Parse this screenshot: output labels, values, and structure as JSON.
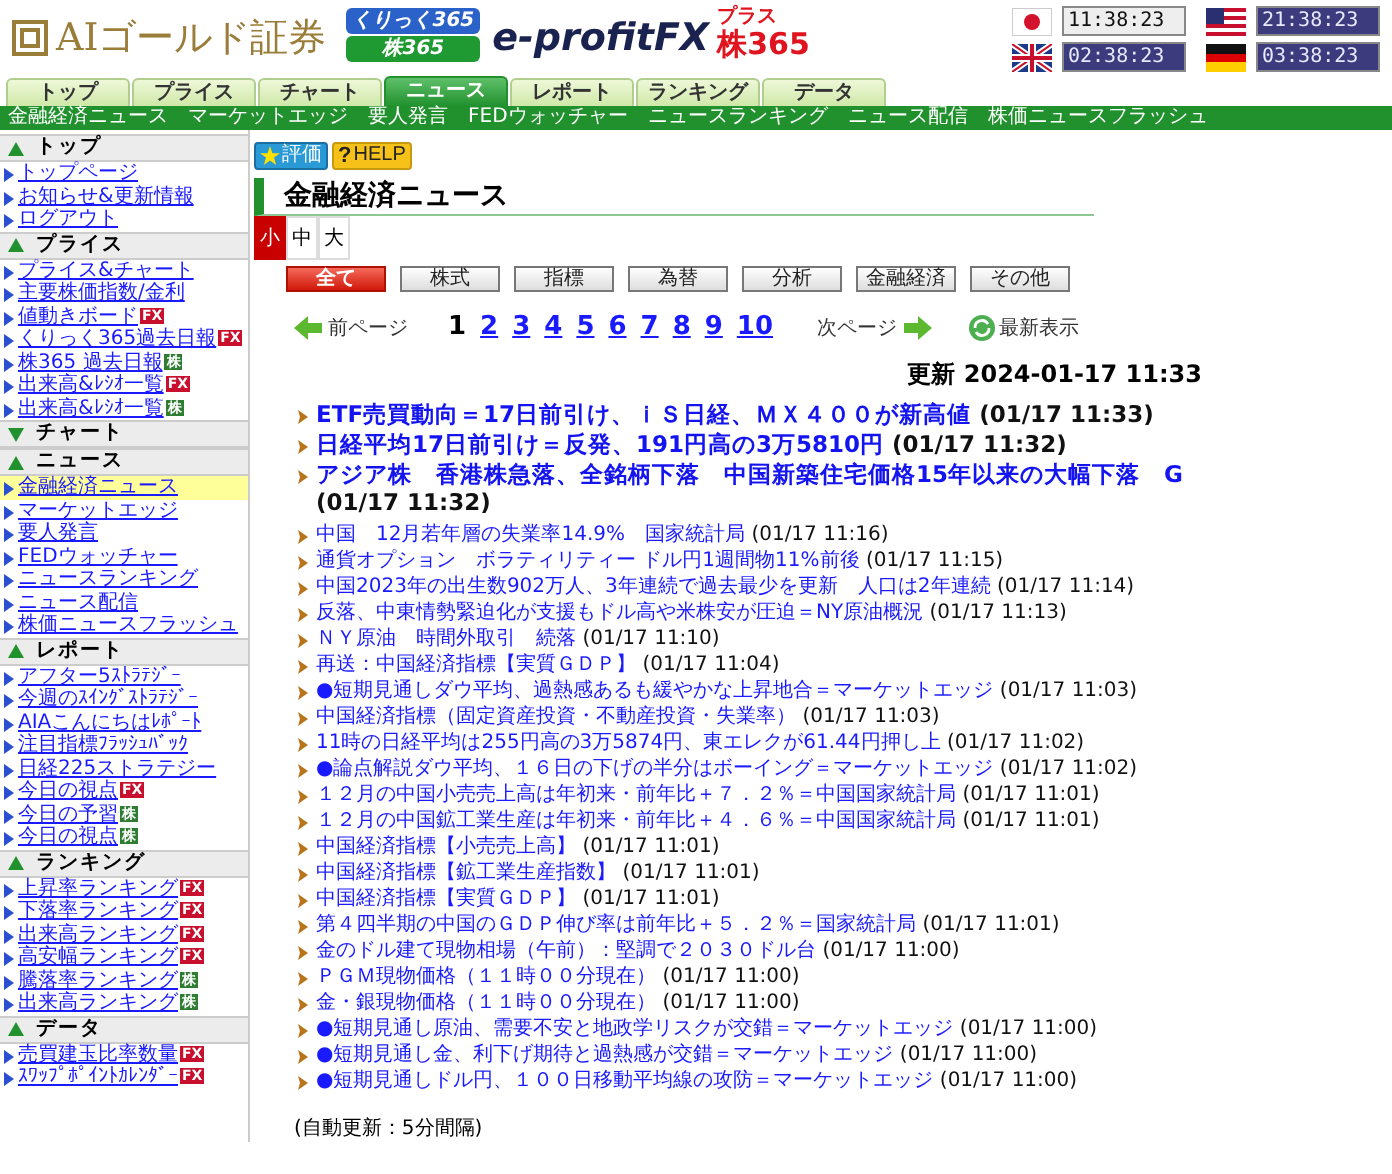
{
  "header": {
    "logo": "AIゴールド証券",
    "badges": [
      {
        "kind": "blue",
        "text": "くりっく365"
      },
      {
        "kind": "green",
        "text": "株365"
      }
    ],
    "brand": "e-profitFX",
    "brand_plus": "プラス",
    "brand_kabu": "株365",
    "clocks": [
      {
        "kind": "jp",
        "time": "11:38:23",
        "local": true
      },
      {
        "kind": "us",
        "time": "21:38:23",
        "local": false
      },
      {
        "kind": "gb",
        "time": "02:38:23",
        "local": false
      },
      {
        "kind": "de",
        "time": "03:38:23",
        "local": false
      }
    ]
  },
  "tabs": [
    {
      "label": "トップ",
      "selected": false
    },
    {
      "label": "プライス",
      "selected": false
    },
    {
      "label": "チャート",
      "selected": false
    },
    {
      "label": "ニュース",
      "selected": true
    },
    {
      "label": "レポート",
      "selected": false
    },
    {
      "label": "ランキング",
      "selected": false
    },
    {
      "label": "データ",
      "selected": false
    }
  ],
  "subnav": [
    "金融経済ニュース",
    "マーケットエッジ",
    "要人発言",
    "FEDウォッチャー",
    "ニュースランキング",
    "ニュース配信",
    "株価ニュースフラッシュ"
  ],
  "sidebar": [
    {
      "title": "トップ",
      "expanded": true,
      "items": [
        {
          "label": "トップページ",
          "selected": false
        },
        {
          "label": "お知らせ&更新情報",
          "selected": false
        },
        {
          "label": "ログアウト",
          "selected": false
        }
      ]
    },
    {
      "title": "プライス",
      "expanded": true,
      "items": [
        {
          "label": "プライス&チャート",
          "selected": false
        },
        {
          "label": "主要株価指数/金利",
          "selected": false
        },
        {
          "label": "値動きボード",
          "selected": false,
          "badge": {
            "kind": "fx",
            "text": "FX"
          }
        },
        {
          "label": "くりっく365過去日報",
          "selected": false,
          "badge": {
            "kind": "fx",
            "text": "FX"
          }
        },
        {
          "label": "株365 過去日報",
          "selected": false,
          "badge": {
            "kind": "kabu",
            "text": "株"
          }
        },
        {
          "label": "出来高&ﾚｼｵ一覧",
          "selected": false,
          "badge": {
            "kind": "fx",
            "text": "FX"
          }
        },
        {
          "label": "出来高&ﾚｼｵ一覧",
          "selected": false,
          "badge": {
            "kind": "kabu",
            "text": "株"
          }
        }
      ]
    },
    {
      "title": "チャート",
      "expanded": false
    },
    {
      "title": "ニュース",
      "expanded": true,
      "items": [
        {
          "label": "金融経済ニュース",
          "selected": true
        },
        {
          "label": "マーケットエッジ",
          "selected": false
        },
        {
          "label": "要人発言",
          "selected": false
        },
        {
          "label": "FEDウォッチャー",
          "selected": false
        },
        {
          "label": "ニュースランキング",
          "selected": false
        },
        {
          "label": "ニュース配信",
          "selected": false
        },
        {
          "label": "株価ニュースフラッシュ",
          "selected": false
        }
      ]
    },
    {
      "title": "レポート",
      "expanded": true,
      "items": [
        {
          "label": "アフター5ｽﾄﾗﾃｼﾞｰ",
          "selected": false
        },
        {
          "label": "今週のｽｲﾝｸﾞｽﾄﾗﾃｼﾞｰ",
          "selected": false
        },
        {
          "label": "AIAこんにちはﾚﾎﾟｰﾄ",
          "selected": false
        },
        {
          "label": "注目指標ﾌﾗｯｼｭﾊﾞｯｸ",
          "selected": false
        },
        {
          "label": "日経225ストラテジー",
          "selected": false
        },
        {
          "label": "今日の視点",
          "selected": false,
          "badge": {
            "kind": "fx",
            "text": "FX"
          }
        },
        {
          "label": "今日の予習",
          "selected": false,
          "badge": {
            "kind": "kabu",
            "text": "株"
          }
        },
        {
          "label": "今日の視点",
          "selected": false,
          "badge": {
            "kind": "kabu",
            "text": "株"
          }
        }
      ]
    },
    {
      "title": "ランキング",
      "expanded": true,
      "items": [
        {
          "label": "上昇率ランキング",
          "selected": false,
          "badge": {
            "kind": "fx",
            "text": "FX"
          }
        },
        {
          "label": "下落率ランキング",
          "selected": false,
          "badge": {
            "kind": "fx",
            "text": "FX"
          }
        },
        {
          "label": "出来高ランキング",
          "selected": false,
          "badge": {
            "kind": "fx",
            "text": "FX"
          }
        },
        {
          "label": "高安幅ランキング",
          "selected": false,
          "badge": {
            "kind": "fx",
            "text": "FX"
          }
        },
        {
          "label": "騰落率ランキング",
          "selected": false,
          "badge": {
            "kind": "kabu",
            "text": "株"
          }
        },
        {
          "label": "出来高ランキング",
          "selected": false,
          "badge": {
            "kind": "kabu",
            "text": "株"
          }
        }
      ]
    },
    {
      "title": "データ",
      "expanded": true,
      "items": [
        {
          "label": "売買建玉比率数量",
          "selected": false,
          "badge": {
            "kind": "fx",
            "text": "FX"
          }
        },
        {
          "label": "ｽﾜｯﾌﾟﾎﾟｲﾝﾄｶﾚﾝﾀﾞｰ",
          "selected": false,
          "badge": {
            "kind": "fx",
            "text": "FX"
          }
        }
      ]
    }
  ],
  "main": {
    "rate_button": "評価",
    "help_mark": "?",
    "help_button": "HELP",
    "title": "金融経済ニュース",
    "font_sizes": [
      {
        "label": "小",
        "selected": true
      },
      {
        "label": "中",
        "selected": false
      },
      {
        "label": "大",
        "selected": false
      }
    ],
    "categories": [
      {
        "label": "全て",
        "selected": true
      },
      {
        "label": "株式",
        "selected": false
      },
      {
        "label": "指標",
        "selected": false
      },
      {
        "label": "為替",
        "selected": false
      },
      {
        "label": "分析",
        "selected": false
      },
      {
        "label": "金融経済",
        "selected": false
      },
      {
        "label": "その他",
        "selected": false
      }
    ],
    "pagination": {
      "prev": "前ページ",
      "pages": [
        {
          "label": "1",
          "selected": true
        },
        {
          "label": "2",
          "selected": false
        },
        {
          "label": "3",
          "selected": false
        },
        {
          "label": "4",
          "selected": false
        },
        {
          "label": "5",
          "selected": false
        },
        {
          "label": "6",
          "selected": false
        },
        {
          "label": "7",
          "selected": false
        },
        {
          "label": "8",
          "selected": false
        },
        {
          "label": "9",
          "selected": false
        },
        {
          "label": "10",
          "selected": false
        }
      ],
      "next": "次ページ",
      "refresh": "最新表示"
    },
    "updated": "更新 2024-01-17 11:33",
    "headlines": [
      {
        "title": "ETF売買動向＝17日前引け、ｉＳ日経、ＭＸ４００が新高値",
        "time": "(01/17 11:33)"
      },
      {
        "title": "日経平均17日前引け＝反発、191円高の3万5810円",
        "time": "(01/17 11:32)"
      },
      {
        "title": "アジア株　香港株急落、全銘柄下落　中国新築住宅価格15年以来の大幅下落　G",
        "time": "(01/17 11:32)"
      }
    ],
    "news": [
      {
        "title": "中国　12月若年層の失業率14.9%　国家統計局",
        "time": "(01/17 11:16)"
      },
      {
        "title": "通貨オプション　ボラティリティー ドル円1週間物11%前後",
        "time": "(01/17 11:15)"
      },
      {
        "title": "中国2023年の出生数902万人、3年連続で過去最少を更新　人口は2年連続",
        "time": "(01/17 11:14)"
      },
      {
        "title": "反落、中東情勢緊迫化が支援もドル高や米株安が圧迫＝NY原油概況",
        "time": "(01/17 11:13)"
      },
      {
        "title": "ＮＹ原油　時間外取引　続落",
        "time": "(01/17 11:10)"
      },
      {
        "title": "再送：中国経済指標【実質ＧＤＰ】",
        "time": "(01/17 11:04)"
      },
      {
        "title": "●短期見通しダウ平均、過熱感あるも緩やかな上昇地合＝マーケットエッジ",
        "time": "(01/17 11:03)"
      },
      {
        "title": "中国経済指標（固定資産投資・不動産投資・失業率）",
        "time": "(01/17 11:03)"
      },
      {
        "title": "11時の日経平均は255円高の3万5874円、東エレクが61.44円押し上",
        "time": "(01/17 11:02)"
      },
      {
        "title": "●論点解説ダウ平均、１６日の下げの半分はボーイング＝マーケットエッジ",
        "time": "(01/17 11:02)"
      },
      {
        "title": "１２月の中国小売売上高は年初来・前年比＋７．２％＝中国国家統計局",
        "time": "(01/17 11:01)"
      },
      {
        "title": "１２月の中国鉱工業生産は年初来・前年比＋４．６％＝中国国家統計局",
        "time": "(01/17 11:01)"
      },
      {
        "title": "中国経済指標【小売売上高】",
        "time": "(01/17 11:01)"
      },
      {
        "title": "中国経済指標【鉱工業生産指数】",
        "time": "(01/17 11:01)"
      },
      {
        "title": "中国経済指標【実質ＧＤＰ】",
        "time": "(01/17 11:01)"
      },
      {
        "title": "第４四半期の中国のＧＤＰ伸び率は前年比＋５．２％＝国家統計局",
        "time": "(01/17 11:01)"
      },
      {
        "title": "金のドル建て現物相場（午前）：堅調で２０３０ドル台",
        "time": "(01/17 11:00)"
      },
      {
        "title": "ＰＧＭ現物価格（１１時００分現在）",
        "time": "(01/17 11:00)"
      },
      {
        "title": "金・銀現物価格（１１時００分現在）",
        "time": "(01/17 11:00)"
      },
      {
        "title": "●短期見通し原油、需要不安と地政学リスクが交錯＝マーケットエッジ",
        "time": "(01/17 11:00)"
      },
      {
        "title": "●短期見通し金、利下げ期待と過熱感が交錯＝マーケットエッジ",
        "time": "(01/17 11:00)"
      },
      {
        "title": "●短期見通しドル円、１００日移動平均線の攻防＝マーケットエッジ",
        "time": "(01/17 11:00)"
      }
    ],
    "auto_update": "(自動更新：5分間隔)"
  }
}
